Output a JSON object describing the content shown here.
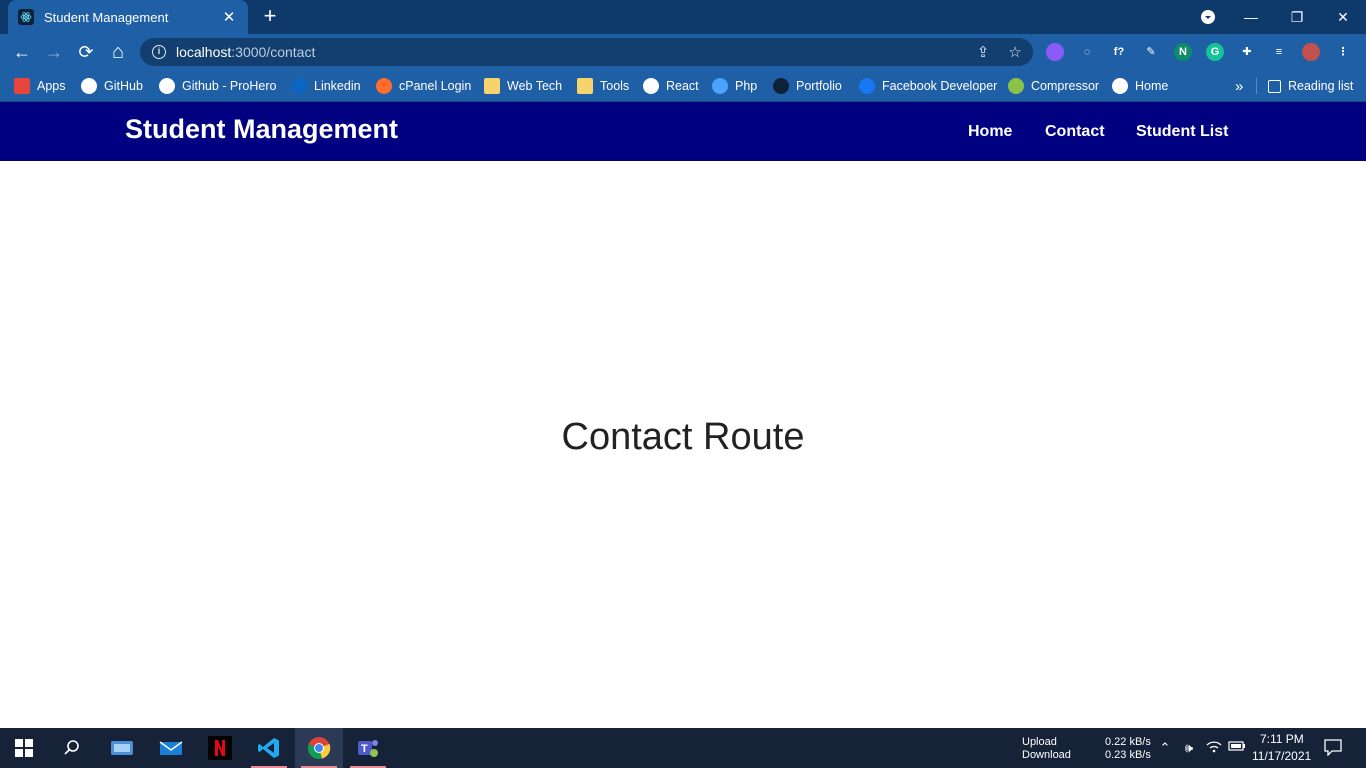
{
  "browser": {
    "tab_title": "Student Management",
    "tab_close": "✕",
    "new_tab": "+",
    "url_host": "localhost",
    "url_rest": ":3000/contact",
    "window_controls": {
      "minimize": "—",
      "restore": "❐",
      "close": "✕"
    },
    "nav": {
      "back": "←",
      "forward": "→",
      "reload": "⟳",
      "home": "⌂"
    },
    "omnibox_icons": {
      "share": "⇪",
      "star": "☆"
    },
    "extensions": [
      {
        "name": "extension-purple",
        "label": "",
        "color": "#8a5cf5"
      },
      {
        "name": "extension-circle",
        "label": "◌",
        "color": "#1f5fa5"
      },
      {
        "name": "extension-f",
        "label": "f?",
        "color": "#1f5fa5"
      },
      {
        "name": "extension-pen",
        "label": "✎",
        "color": "#1f5fa5"
      },
      {
        "name": "extension-n",
        "label": "N",
        "color": "#0f8a6a"
      },
      {
        "name": "grammarly-extension",
        "label": "G",
        "color": "#15c39a"
      },
      {
        "name": "extensions-puzzle",
        "label": "✚",
        "color": "#1f5fa5"
      },
      {
        "name": "reading-mode",
        "label": "≡",
        "color": "#1f5fa5"
      },
      {
        "name": "profile-avatar",
        "label": "",
        "color": "#c2524f"
      },
      {
        "name": "menu-kebab",
        "label": "⋮",
        "color": "#1f5fa5"
      }
    ]
  },
  "bookmarks": [
    {
      "label": "Apps",
      "icon": "apps-grid-icon",
      "color": "#e8453c"
    },
    {
      "label": "GitHub",
      "icon": "github-icon",
      "color": "#ffffff"
    },
    {
      "label": "Github - ProHero",
      "icon": "github-icon",
      "color": "#ffffff"
    },
    {
      "label": "Linkedin",
      "icon": "linkedin-icon",
      "color": "#0a66c2"
    },
    {
      "label": "cPanel Login",
      "icon": "cpanel-icon",
      "color": "#ff6c2c"
    },
    {
      "label": "Web Tech",
      "icon": "folder-icon",
      "color": "#f6d36b"
    },
    {
      "label": "Tools",
      "icon": "folder-icon",
      "color": "#f6d36b"
    },
    {
      "label": "React",
      "icon": "github-icon",
      "color": "#ffffff"
    },
    {
      "label": "Php",
      "icon": "cloud-icon",
      "color": "#4aa3ff"
    },
    {
      "label": "Portfolio",
      "icon": "react-icon",
      "color": "#0d2238"
    },
    {
      "label": "Facebook Developer",
      "icon": "facebook-icon",
      "color": "#1877f2"
    },
    {
      "label": "Compressor",
      "icon": "compressor-icon",
      "color": "#8bc34a"
    },
    {
      "label": "Home",
      "icon": "globe-icon",
      "color": "#ffffff"
    }
  ],
  "bookmarks_overflow": "»",
  "reading_list": "Reading list",
  "page": {
    "brand": "Student Management",
    "nav": [
      "Home",
      "Contact",
      "Student List"
    ],
    "heading": "Contact Route"
  },
  "taskbar": {
    "upload_label": "Upload",
    "download_label": "Download",
    "upload_rate": "0.22 kB/s",
    "download_rate": "0.23 kB/s",
    "time": "7:11 PM",
    "date": "11/17/2021"
  }
}
